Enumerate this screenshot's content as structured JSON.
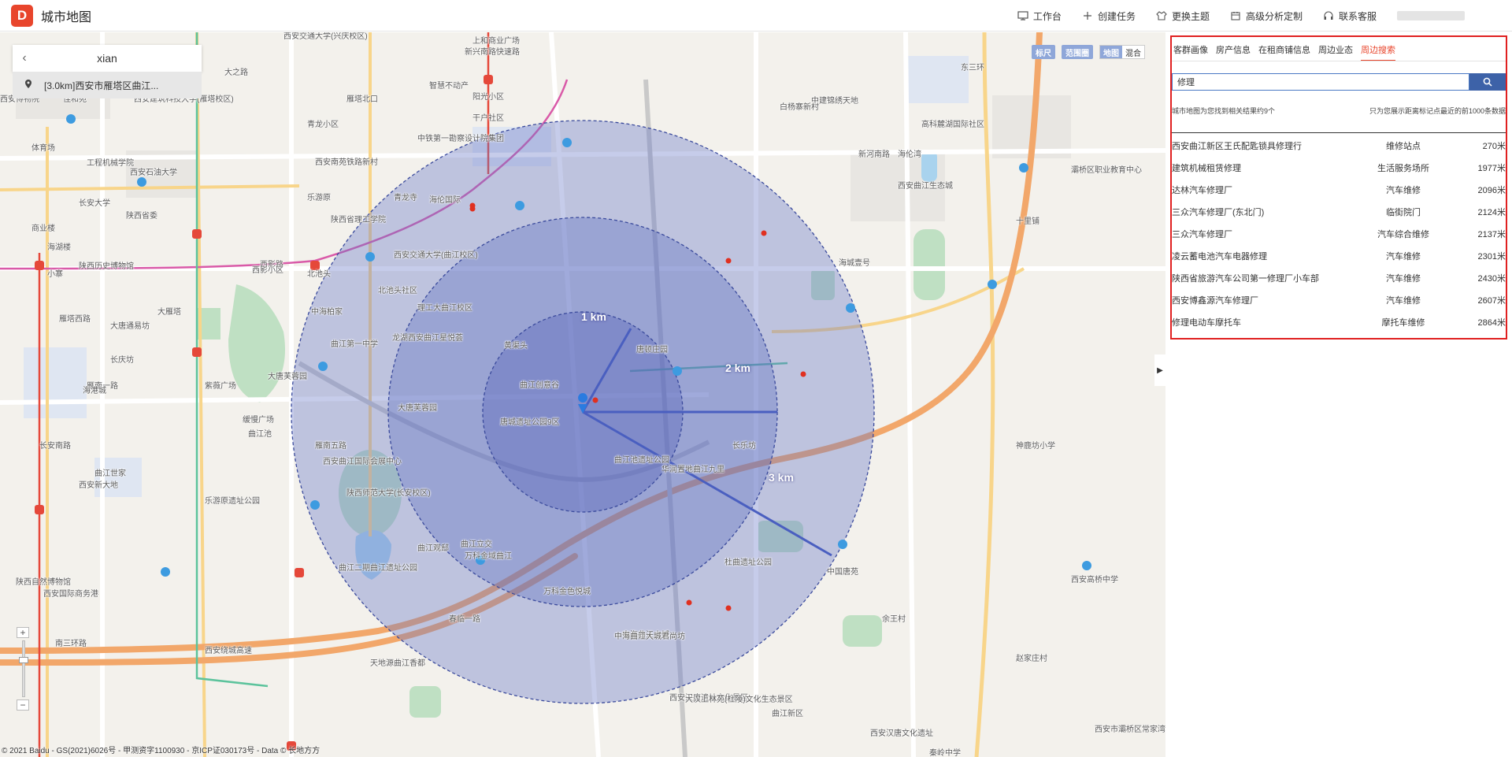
{
  "app": {
    "logo_letter": "D",
    "title": "城市地图"
  },
  "header": {
    "nav": [
      {
        "label": "工作台",
        "icon": "monitor-icon"
      },
      {
        "label": "创建任务",
        "icon": "plus-icon"
      },
      {
        "label": "更换主题",
        "icon": "shirt-icon"
      },
      {
        "label": "高级分析定制",
        "icon": "calendar-icon"
      },
      {
        "label": "联系客服",
        "icon": "headset-icon"
      }
    ]
  },
  "map": {
    "search_value": "xian",
    "suggestion": "[3.0km]西安市雁塔区曲江...",
    "tools": {
      "ruler": "标尺",
      "range": "范围圈",
      "map": "地图",
      "hybrid": "混合"
    },
    "zoom_in": "+",
    "zoom_out": "−",
    "radius_labels": [
      "1 km",
      "2 km",
      "3 km"
    ],
    "copyright": "© 2021 Baidu - GS(2021)6026号 - 甲测资字1100930 - 京ICP证030173号 - Data © 长地方方",
    "labels": [
      "西安交通大学(兴庆校区)",
      "上和商业广场",
      "新兴南路快速路",
      "大之路",
      "建东街",
      "智慧不动产",
      "阳光小区",
      "西安博物院",
      "佳和苑",
      "西安建筑科技大学(雁塔校区)",
      "雁塔北口",
      "干户社区",
      "青龙小区",
      "中铁第一勘察设计院集团",
      "体育场",
      "工程机械学院",
      "西安石油大学",
      "西安南苑铁路新村",
      "青龙寺",
      "海伦国际",
      "长安大学",
      "乐游原",
      "陕西省委",
      "陕西省理工学院",
      "商业楼",
      "海湖楼",
      "陕西历史博物馆",
      "西影路",
      "北池头",
      "小寨",
      "大雁塔",
      "西安交通大学(曲江校区)",
      "西影小区",
      "北池头社区",
      "理工大曲江校区",
      "雁塔西路",
      "大唐通易坊",
      "中海柏家",
      "曲江第一中学",
      "龙湖西安曲江星悦荟",
      "黄渠头",
      "唐顿庄园",
      "长庆坊",
      "大唐芙蓉园",
      "曲江创意谷",
      "雁南一路",
      "海港城",
      "紫薇广场",
      "大唐芙蓉园",
      "唐城遗址公园9区",
      "缓慢广场",
      "曲江池",
      "雁南五路",
      "西安曲江国际会展中心",
      "曲江世家",
      "西安新大地",
      "陕西师范大学(长安校区)",
      "曲江池遗址公园",
      "华润置地曲江九里",
      "长乐坊",
      "乐游原遗址公园",
      "曲江观邸",
      "万科金域曲江",
      "曲江立交",
      "杜曲遗址公园",
      "曲江二期曲江遗址公园",
      "陕西自然博物馆",
      "西安国际商务港",
      "西安绕城高速",
      "南三环路",
      "万科金色悦城",
      "中海曲江大城",
      "春临一路",
      "天地源曲江香都",
      "中海曲江大城君尚坊",
      "西安汉唐遗址文化景区",
      "曲江新区",
      "中建锦绣天地",
      "白杨寨新村",
      "高科麓湖国际社区",
      "新河南路",
      "西安曲江生态城",
      "灞桥区职业教育中心",
      "海伦湾",
      "十里铺",
      "海城壹号",
      "神鹿坊小学",
      "西安高桥中学",
      "中国唐苑",
      "西安汉唐文化遗址",
      "西安市灞桥区常家湾小学",
      "大汉上林苑(杜陵)文化生态景区",
      "赵家庄村",
      "余王村",
      "秦岭中学",
      "长安南路",
      "东三环"
    ]
  },
  "panel": {
    "tabs": [
      "客群画像",
      "房产信息",
      "在租商铺信息",
      "周边业态",
      "周边搜索"
    ],
    "active_tab": 4,
    "search": {
      "value": "修理",
      "placeholder": ""
    },
    "result_summary": "城市地图为您找到相关结果约9个",
    "result_limit": "只为您展示距离标记点最近的前1000条数据",
    "results": [
      {
        "name": "西安曲江新区王氏配匙锁具修理行",
        "type": "维修站点",
        "distance": "270米"
      },
      {
        "name": "建筑机械租赁修理",
        "type": "生活服务场所",
        "distance": "1977米"
      },
      {
        "name": "达林汽车修理厂",
        "type": "汽车维修",
        "distance": "2096米"
      },
      {
        "name": "三众汽车修理厂(东北门)",
        "type": "临街院门",
        "distance": "2124米"
      },
      {
        "name": "三众汽车修理厂",
        "type": "汽车综合维修",
        "distance": "2137米"
      },
      {
        "name": "凌云蓄电池汽车电器修理",
        "type": "汽车维修",
        "distance": "2301米"
      },
      {
        "name": "陕西省旅游汽车公司第一修理厂小车部",
        "type": "汽车维修",
        "distance": "2430米"
      },
      {
        "name": "西安博鑫源汽车修理厂",
        "type": "汽车维修",
        "distance": "2607米"
      },
      {
        "name": "修理电动车摩托车",
        "type": "摩托车维修",
        "distance": "2864米"
      }
    ]
  },
  "colors": {
    "brand": "#e8452c",
    "circle_fill": "#6a78c8",
    "search_button": "#3d62a8",
    "highlight_frame": "#e02020"
  }
}
